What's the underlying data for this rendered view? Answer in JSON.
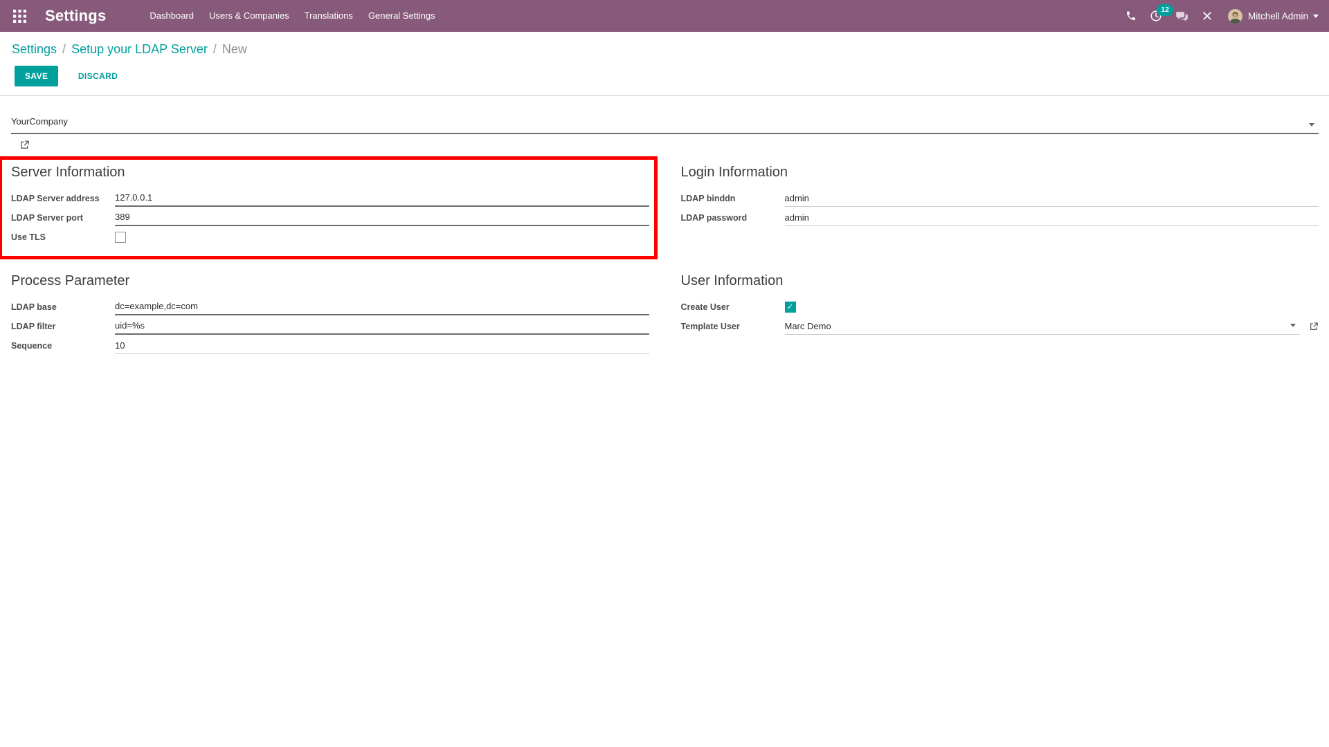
{
  "colors": {
    "topbar_bg": "#875A7B",
    "accent": "#00A09D",
    "highlight_border": "#FF0000",
    "underline_required": "#6b6b6b",
    "underline_normal": "#cccccc"
  },
  "topbar": {
    "title": "Settings",
    "menu": [
      {
        "label": "Dashboard"
      },
      {
        "label": "Users & Companies"
      },
      {
        "label": "Translations"
      },
      {
        "label": "General Settings"
      }
    ],
    "activity_badge": "12",
    "user": {
      "name": "Mitchell Admin"
    }
  },
  "breadcrumb": {
    "links": [
      {
        "label": "Settings"
      },
      {
        "label": "Setup your LDAP Server"
      }
    ],
    "current": "New",
    "separator": "/"
  },
  "toolbar": {
    "save_label": "SAVE",
    "discard_label": "DISCARD"
  },
  "form": {
    "company_field": {
      "value": "YourCompany"
    },
    "sections": [
      {
        "title": "Server Information",
        "column": 1,
        "highlighted": true,
        "fields": [
          {
            "label": "LDAP Server address",
            "type": "text",
            "value": "127.0.0.1",
            "required": true
          },
          {
            "label": "LDAP Server port",
            "type": "text",
            "value": "389",
            "required": true
          },
          {
            "label": "Use TLS",
            "type": "checkbox",
            "checked": false
          }
        ]
      },
      {
        "title": "Login Information",
        "column": 2,
        "highlighted": false,
        "fields": [
          {
            "label": "LDAP binddn",
            "type": "text",
            "value": "admin",
            "required": false
          },
          {
            "label": "LDAP password",
            "type": "text",
            "value": "admin",
            "required": false
          }
        ]
      },
      {
        "title": "Process Parameter",
        "column": 1,
        "highlighted": false,
        "fields": [
          {
            "label": "LDAP base",
            "type": "text",
            "value": "dc=example,dc=com",
            "required": true
          },
          {
            "label": "LDAP filter",
            "type": "text",
            "value": "uid=%s",
            "required": true
          },
          {
            "label": "Sequence",
            "type": "text",
            "value": "10",
            "required": false
          }
        ]
      },
      {
        "title": "User Information",
        "column": 2,
        "highlighted": false,
        "fields": [
          {
            "label": "Create User",
            "type": "checkbox",
            "checked": true
          },
          {
            "label": "Template User",
            "type": "many2one",
            "value": "Marc Demo",
            "required": false
          }
        ]
      }
    ]
  },
  "icons": {
    "check": "✓",
    "apps_menu": "grid-3x3",
    "phone": "phone-handset",
    "activity_clock": "clock",
    "messages": "chat-bubbles",
    "developer_tools": "crossed-tools",
    "external_link": "box-arrow-out",
    "caret": "caret-down"
  }
}
